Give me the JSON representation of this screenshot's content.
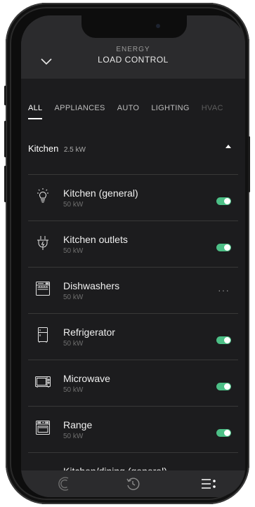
{
  "header": {
    "subtitle": "ENERGY",
    "title": "LOAD CONTROL"
  },
  "tabs": [
    "ALL",
    "APPLIANCES",
    "AUTO",
    "LIGHTING",
    "HVAC"
  ],
  "section": {
    "name": "Kitchen",
    "power": "2.5 kW"
  },
  "items": [
    {
      "name": "Kitchen (general)",
      "power": "50 kW",
      "icon": "lightbulb-icon",
      "state": "on"
    },
    {
      "name": "Kitchen outlets",
      "power": "50 kW",
      "icon": "plug-icon",
      "state": "on"
    },
    {
      "name": "Dishwashers",
      "power": "50 kW",
      "icon": "dishwasher-icon",
      "state": "more"
    },
    {
      "name": "Refrigerator",
      "power": "50 kW",
      "icon": "refrigerator-icon",
      "state": "on"
    },
    {
      "name": "Microwave",
      "power": "50 kW",
      "icon": "microwave-icon",
      "state": "on"
    },
    {
      "name": "Range",
      "power": "50 kW",
      "icon": "range-icon",
      "state": "on"
    },
    {
      "name": "Kitchen/dining (general)",
      "power": "",
      "icon": "floorplan-icon",
      "state": "on"
    }
  ],
  "more_label": "···",
  "colors": {
    "toggle_on": "#4cbf86",
    "background": "#1c1c1e",
    "header": "#2b2b2d"
  },
  "tabbar": [
    "energy-icon",
    "history-icon",
    "menu-icon"
  ]
}
